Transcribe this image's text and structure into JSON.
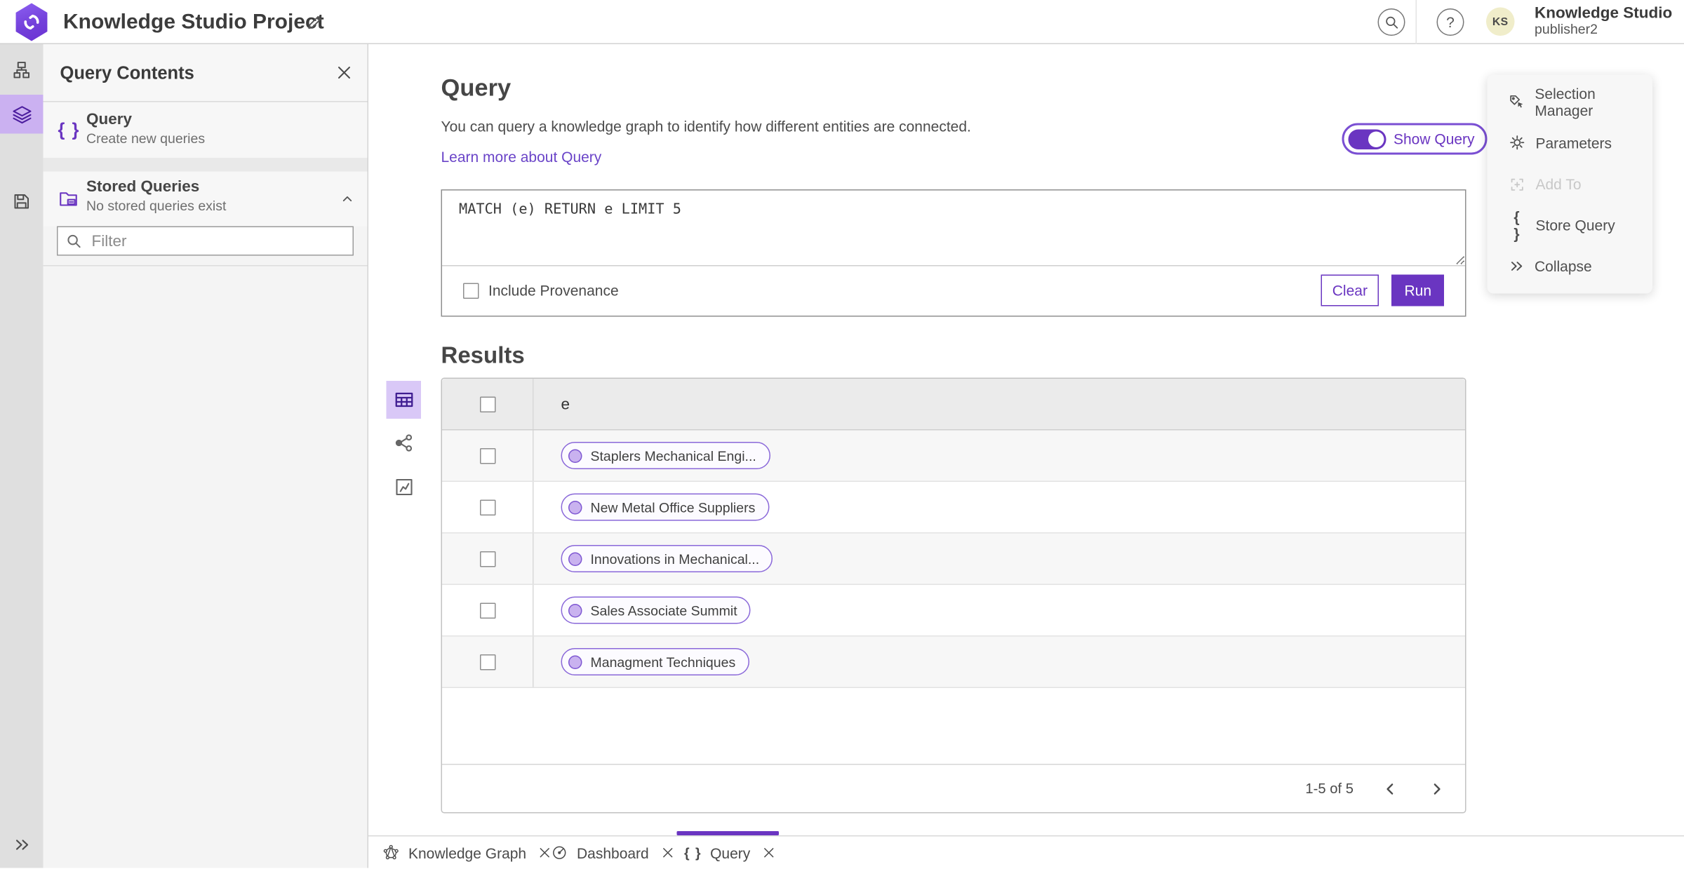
{
  "topbar": {
    "title": "Knowledge Studio Project",
    "user_initials": "KS",
    "user_name": "Knowledge Studio",
    "user_role": "publisher2"
  },
  "panel": {
    "title": "Query Contents",
    "query_item": {
      "title": "Query",
      "subtitle": "Create new queries"
    },
    "stored_item": {
      "title": "Stored Queries",
      "subtitle": "No stored queries exist"
    },
    "filter_placeholder": "Filter"
  },
  "main": {
    "heading": "Query",
    "description": "You can query a knowledge graph to identify how different entities are connected.",
    "learn_more": "Learn more about Query",
    "show_query": "Show Query",
    "query_text": "MATCH (e) RETURN e LIMIT 5",
    "include_provenance": "Include Provenance",
    "clear": "Clear",
    "run": "Run",
    "results_heading": "Results",
    "column": "e",
    "rows": [
      "Staplers Mechanical Engi...",
      "New Metal Office Suppliers",
      "Innovations in Mechanical...",
      "Sales Associate Summit",
      "Managment Techniques"
    ],
    "pagination": "1-5 of 5"
  },
  "tools": {
    "selection_manager": "Selection Manager",
    "parameters": "Parameters",
    "add_to": "Add To",
    "store_query": "Store Query",
    "collapse": "Collapse"
  },
  "tabs": {
    "knowledge_graph": "Knowledge Graph",
    "dashboard": "Dashboard",
    "query": "Query"
  },
  "colors": {
    "accent": "#6a35c1",
    "accent_light": "#cbb1f1",
    "selected_view_bg": "#d9c8f7",
    "avatar_bg": "#f0edca",
    "pill_dot": "#c9b2ef",
    "pill_border": "#8a68d9"
  }
}
